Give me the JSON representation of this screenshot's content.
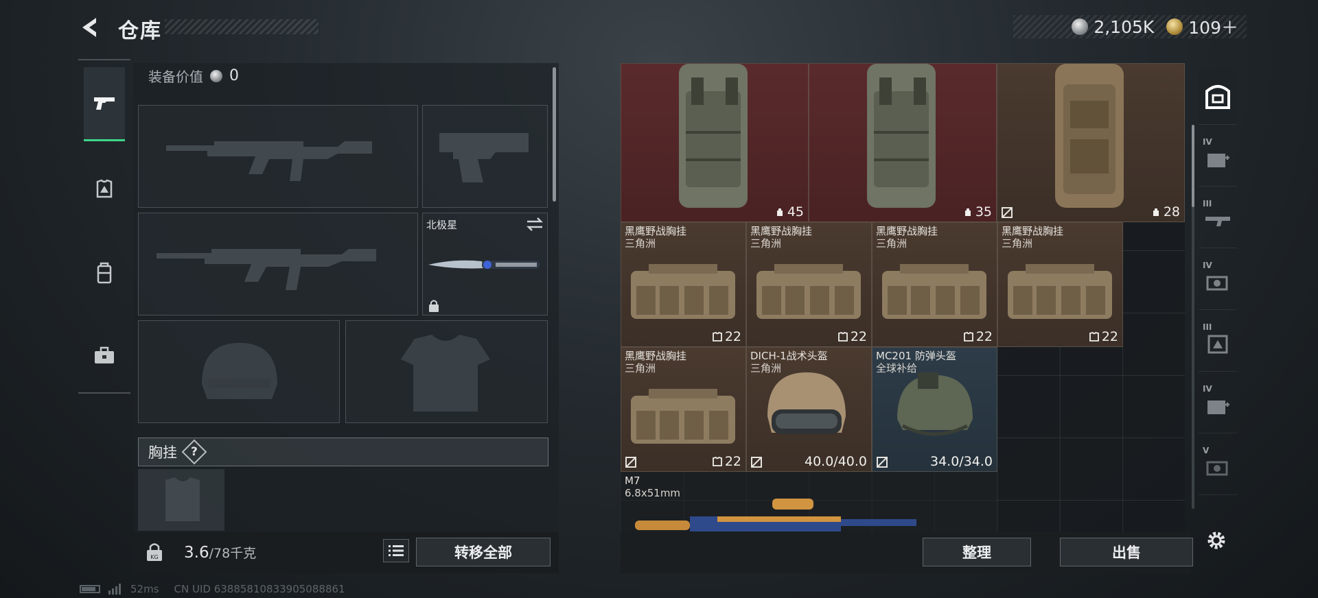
{
  "header": {
    "title": "仓库",
    "currency": [
      {
        "type": "silver",
        "value": "2,105K"
      },
      {
        "type": "gold",
        "value": "109＋"
      }
    ]
  },
  "left_rail": [
    "pistol-icon",
    "armor-icon",
    "backpack-icon",
    "toolbox-icon"
  ],
  "equipment": {
    "value_label": "装备价值",
    "value": "0",
    "knife_name": "北极星",
    "chest_label": "胸挂",
    "help": "?",
    "weight_current": "3.6",
    "weight_max": "/78千克",
    "transfer_all": "转移全部"
  },
  "inventory": {
    "items": [
      {
        "name": "",
        "sub": "",
        "stat": "45",
        "stat_icon": "capacity-icon"
      },
      {
        "name": "",
        "sub": "",
        "stat": "35",
        "stat_icon": "capacity-icon"
      },
      {
        "name": "",
        "sub": "",
        "stat": "28",
        "stat_icon": "capacity-icon"
      },
      {
        "name": "黑鹰野战胸挂",
        "sub": "三角洲",
        "stat": "22",
        "stat_icon": "vest-icon"
      },
      {
        "name": "黑鹰野战胸挂",
        "sub": "三角洲",
        "stat": "22",
        "stat_icon": "vest-icon"
      },
      {
        "name": "黑鹰野战胸挂",
        "sub": "三角洲",
        "stat": "22",
        "stat_icon": "vest-icon"
      },
      {
        "name": "黑鹰野战胸挂",
        "sub": "三角洲",
        "stat": "22",
        "stat_icon": "vest-icon"
      },
      {
        "name": "黑鹰野战胸挂",
        "sub": "三角洲",
        "stat": "22",
        "stat_icon": "vest-icon"
      },
      {
        "name": "DICH-1战术头盔",
        "sub": "三角洲",
        "stat": "40.0/40.0",
        "stat_icon": ""
      },
      {
        "name": "MC201 防弹头盔",
        "sub": "全球补给",
        "stat": "34.0/34.0",
        "stat_icon": ""
      },
      {
        "name": "M7",
        "sub": "6.8x51mm",
        "stat": "",
        "stat_icon": ""
      }
    ],
    "sort_label": "整理",
    "sell_label": "出售"
  },
  "right_rail": [
    {
      "tier": "",
      "icon": "backpack-filter-icon"
    },
    {
      "tier": "IV",
      "icon": "medkit-filter-icon"
    },
    {
      "tier": "III",
      "icon": "rifle-filter-icon"
    },
    {
      "tier": "IV",
      "icon": "scope-filter-icon"
    },
    {
      "tier": "III",
      "icon": "armor-filter-icon"
    },
    {
      "tier": "IV",
      "icon": "medkit-filter-icon"
    },
    {
      "tier": "V",
      "icon": "scope-filter-icon"
    }
  ],
  "status": {
    "ping": "52ms",
    "uid": "CN UID 63885810833905088861"
  },
  "colors": {
    "accent_green": "#3ed68a",
    "red_rarity": "#5a2a2b",
    "brown_rarity": "#4a3a2f",
    "blue_rarity": "#2d3c48"
  }
}
